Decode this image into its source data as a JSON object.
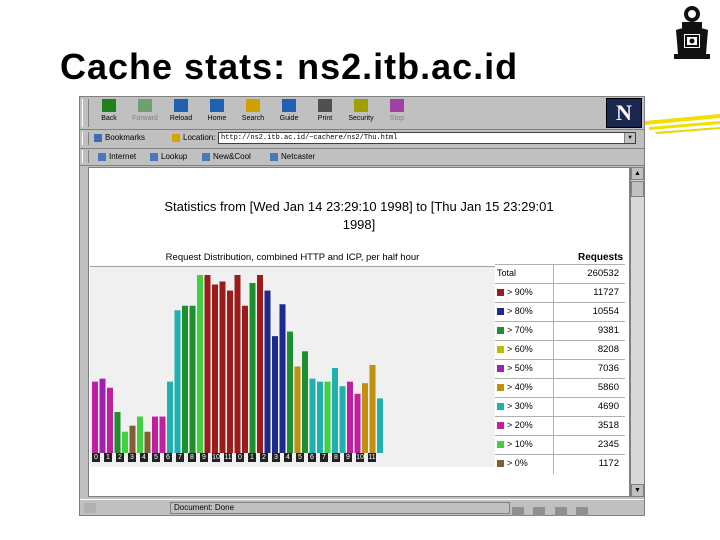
{
  "slide": {
    "title": "Cache stats: ns2.itb.ac.id"
  },
  "toolbar": {
    "buttons": [
      {
        "label": "Back",
        "icon": "back-arrow-icon",
        "enabled": true
      },
      {
        "label": "Forward",
        "icon": "forward-arrow-icon",
        "enabled": false
      },
      {
        "label": "Reload",
        "icon": "reload-icon",
        "enabled": true
      },
      {
        "label": "Home",
        "icon": "home-icon",
        "enabled": true
      },
      {
        "label": "Search",
        "icon": "search-icon",
        "enabled": true
      },
      {
        "label": "Guide",
        "icon": "guide-icon",
        "enabled": true
      },
      {
        "label": "Print",
        "icon": "print-icon",
        "enabled": true
      },
      {
        "label": "Security",
        "icon": "security-lock-icon",
        "enabled": true
      },
      {
        "label": "Stop",
        "icon": "stop-icon",
        "enabled": false
      }
    ],
    "logo_letter": "N"
  },
  "location": {
    "bookmarks_label": "Bookmarks",
    "location_label": "Location:",
    "url": "http://ns2.itb.ac.id/~cachere/ns2/Thu.html"
  },
  "links": [
    "Internet",
    "Lookup",
    "New&Cool",
    "Netcaster"
  ],
  "page": {
    "heading_line1": "Statistics from [Wed Jan 14 23:29:10 1998] to [Thu Jan 15 23:29:01",
    "heading_line2": "1998]",
    "chart_title": "Request Distribution, combined HTTP and ICP, per half hour",
    "requests_header": "Requests",
    "stats": [
      {
        "label": "Total",
        "value": "260532",
        "color": ""
      },
      {
        "label": "> 90%",
        "value": "11727",
        "color": "#9c1c1c"
      },
      {
        "label": "> 80%",
        "value": "10554",
        "color": "#1c2a8c"
      },
      {
        "label": "> 70%",
        "value": "9381",
        "color": "#1e8f2e"
      },
      {
        "label": "> 60%",
        "value": "8208",
        "color": "#b8c000"
      },
      {
        "label": "> 50%",
        "value": "7036",
        "color": "#a020b0"
      },
      {
        "label": "> 40%",
        "value": "5860",
        "color": "#c09010"
      },
      {
        "label": "> 30%",
        "value": "4690",
        "color": "#20b0b0"
      },
      {
        "label": "> 20%",
        "value": "3518",
        "color": "#c020a0"
      },
      {
        "label": "> 10%",
        "value": "2345",
        "color": "#40d040"
      },
      {
        "label": "> 0%",
        "value": "1172",
        "color": "#806030"
      }
    ]
  },
  "chart_data": {
    "type": "bar",
    "title": "Request Distribution, combined HTTP and ICP, per half hour",
    "x_tick_labels": [
      "0",
      "1",
      "2",
      "3",
      "4",
      "5",
      "6",
      "7",
      "8",
      "9",
      "10",
      "11",
      "0",
      "1",
      "2",
      "3",
      "4",
      "5",
      "6",
      "7",
      "8",
      "9",
      "10",
      "11"
    ],
    "ylim": [
      0,
      11727
    ],
    "values": [
      4700,
      4900,
      4300,
      2700,
      1400,
      1800,
      2400,
      1400,
      2400,
      2400,
      4700,
      9400,
      9700,
      9700,
      11727,
      11727,
      11100,
      11300,
      10700,
      11727,
      9700,
      11200,
      11727,
      10700,
      7700,
      9800,
      8000,
      5700,
      6700,
      4900,
      4700,
      4700,
      5600,
      4400,
      4700,
      3900,
      4600,
      5800,
      3600
    ],
    "colors": [
      "#c020a0",
      "#a020b0",
      "#c020a0",
      "#1e8f2e",
      "#40d040",
      "#806030",
      "#40d040",
      "#806030",
      "#c020a0",
      "#c020a0",
      "#20b0b0",
      "#20b0b0",
      "#1e8f2e",
      "#1e8f2e",
      "#40d040",
      "#9c1c1c",
      "#9c1c1c",
      "#9c1c1c",
      "#9c1c1c",
      "#9c1c1c",
      "#9c1c1c",
      "#1e8f2e",
      "#9c1c1c",
      "#1c2a8c",
      "#1c2a8c",
      "#1c2a8c",
      "#1e8f2e",
      "#c09010",
      "#1e8f2e",
      "#20b0b0",
      "#20b0b0",
      "#40d040",
      "#20b0b0",
      "#20b0b0",
      "#c020a0",
      "#c020a0",
      "#c09010",
      "#c09010",
      "#20b0b0"
    ]
  },
  "status": {
    "text": "Document: Done"
  }
}
